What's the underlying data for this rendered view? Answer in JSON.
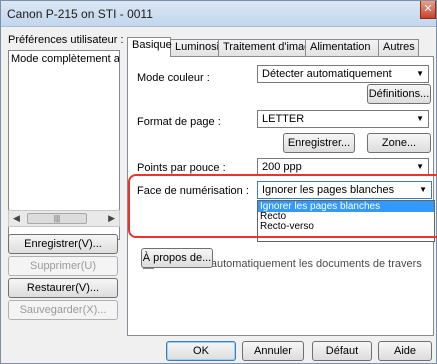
{
  "window": {
    "title": "Canon P-215 on STI - 0011"
  },
  "left_pane": {
    "label": "Préférences utilisateur :",
    "list_items": [
      "Mode complètement au"
    ],
    "buttons": [
      "Enregistrer(V)...",
      "Supprimer(U)",
      "Restaurer(V)...",
      "Sauvegarder(X)..."
    ]
  },
  "tabs": [
    "Basique",
    "Luminosité",
    "Traitement d'image",
    "Alimentation",
    "Autres"
  ],
  "basic": {
    "mode_couleur": {
      "label": "Mode couleur :",
      "value": "Détecter automatiquement"
    },
    "definitions_button": "Définitions...",
    "format_page": {
      "label": "Format de page :",
      "value": "LETTER"
    },
    "enregistrer_button": "Enregistrer...",
    "zone_button": "Zone...",
    "points_pouce": {
      "label": "Points par pouce :",
      "value": "200 ppp"
    },
    "face_numerisation": {
      "label": "Face de numérisation :",
      "value": "Ignorer les pages blanches",
      "options": [
        "Ignorer les pages blanches",
        "Recto",
        "Recto-verso"
      ]
    },
    "checkbox_label": "Redresser automatiquement les documents de travers",
    "apropos_button": "À propos de..."
  },
  "footer": {
    "ok": "OK",
    "annuler": "Annuler",
    "defaut": "Défaut",
    "aide": "Aide"
  }
}
